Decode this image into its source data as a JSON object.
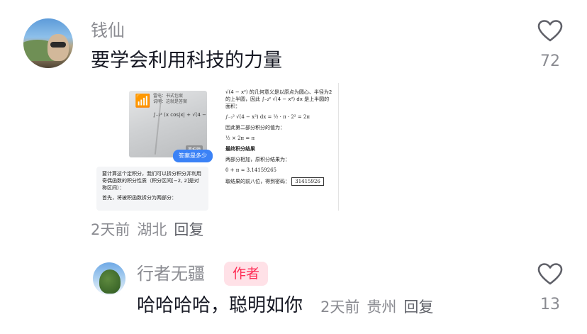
{
  "comments": [
    {
      "username": "钱仙",
      "text": "要学会利用科技的力量",
      "time": "2天前",
      "location": "湖北",
      "reply_label": "回复",
      "likes": "72",
      "avatar_icon": "avatar-mountain-selfie"
    },
    {
      "username": "行者无疆",
      "badge": "作者",
      "text": "哈哈哈哈，聪明如你",
      "time": "2天前",
      "location": "贵州",
      "reply_label": "回复",
      "likes": "13",
      "avatar_icon": "avatar-tree"
    }
  ],
  "attachment": {
    "left": {
      "photo_note": "雷电：书式包案\n说明：这就是答案",
      "photo_formula": "∫₋₂² (x cos|x| + √(4 − x²)) dx",
      "photo_tag": "重拍题",
      "ask_bubble": "答案是多少",
      "answer_p1": "要计算这个定积分，我们可以拆分积分并利用奇偶函数的积分性质（积分区间[−2, 2]是对称区间）：",
      "answer_p2": "首先，将被积函数拆分为两部分："
    },
    "right": {
      "line1": "√(4 − x²) 的几何意义是以原点为圆心、半径为2的上半圆，因此 ∫₋₂² √(4 − x²) dx 是上半圆的面积：",
      "line2": "∫₋₂² √(4 − x²) dx = ½ · π · 2² = 2π",
      "line3": "因此第二部分积分的值为：",
      "line4": "½ × 2π = π",
      "heading": "最终积分结果",
      "line5": "两部分相加，原积分结果为：",
      "line6": "0 + π ≈ 3.14159265",
      "line7": "取结果的前八位，得到密码：",
      "code": "31415926"
    }
  },
  "colors": {
    "accent": "#fe2c55",
    "badge_bg": "#ffe1e7",
    "meta": "#8a8b91",
    "text": "#161823",
    "ask_bubble": "#3b82f6"
  },
  "icons": {
    "like": "heart-outline-icon"
  }
}
